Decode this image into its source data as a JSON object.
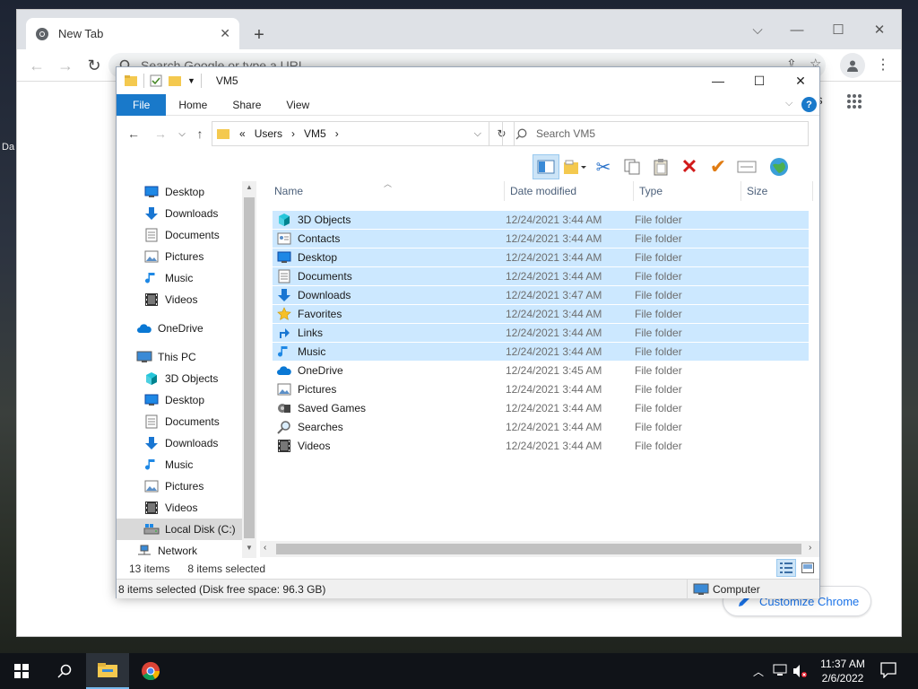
{
  "desktop": {
    "label": "Da"
  },
  "chrome": {
    "tab_title": "New Tab",
    "omnibox_placeholder": "Search Google or type a URL",
    "apps_label": "ges",
    "customize_label": "Customize Chrome"
  },
  "explorer": {
    "title": "VM5",
    "ribbon": [
      "File",
      "Home",
      "Share",
      "View"
    ],
    "address": [
      "Users",
      "VM5"
    ],
    "address_prefix": "«",
    "search_placeholder": "Search VM5",
    "nav": {
      "quick": [
        {
          "label": "Desktop",
          "icon": "desktop-icon"
        },
        {
          "label": "Downloads",
          "icon": "downloads-icon"
        },
        {
          "label": "Documents",
          "icon": "documents-icon"
        },
        {
          "label": "Pictures",
          "icon": "pictures-icon"
        },
        {
          "label": "Music",
          "icon": "music-icon"
        },
        {
          "label": "Videos",
          "icon": "videos-icon"
        }
      ],
      "onedrive": "OneDrive",
      "thispc": "This PC",
      "pc_items": [
        {
          "label": "3D Objects",
          "icon": "3d-objects-icon"
        },
        {
          "label": "Desktop",
          "icon": "desktop-icon"
        },
        {
          "label": "Documents",
          "icon": "documents-icon"
        },
        {
          "label": "Downloads",
          "icon": "downloads-icon"
        },
        {
          "label": "Music",
          "icon": "music-icon"
        },
        {
          "label": "Pictures",
          "icon": "pictures-icon"
        },
        {
          "label": "Videos",
          "icon": "videos-icon"
        },
        {
          "label": "Local Disk (C:)",
          "icon": "drive-icon"
        }
      ],
      "network": "Network"
    },
    "columns": [
      "Name",
      "Date modified",
      "Type",
      "Size"
    ],
    "rows": [
      {
        "name": "3D Objects",
        "date": "12/24/2021 3:44 AM",
        "type": "File folder",
        "icon": "3d-objects-icon",
        "selected": true
      },
      {
        "name": "Contacts",
        "date": "12/24/2021 3:44 AM",
        "type": "File folder",
        "icon": "contacts-icon",
        "selected": true
      },
      {
        "name": "Desktop",
        "date": "12/24/2021 3:44 AM",
        "type": "File folder",
        "icon": "desktop-icon",
        "selected": true
      },
      {
        "name": "Documents",
        "date": "12/24/2021 3:44 AM",
        "type": "File folder",
        "icon": "documents-icon",
        "selected": true
      },
      {
        "name": "Downloads",
        "date": "12/24/2021 3:47 AM",
        "type": "File folder",
        "icon": "downloads-icon",
        "selected": true
      },
      {
        "name": "Favorites",
        "date": "12/24/2021 3:44 AM",
        "type": "File folder",
        "icon": "favorites-icon",
        "selected": true
      },
      {
        "name": "Links",
        "date": "12/24/2021 3:44 AM",
        "type": "File folder",
        "icon": "links-icon",
        "selected": true
      },
      {
        "name": "Music",
        "date": "12/24/2021 3:44 AM",
        "type": "File folder",
        "icon": "music-icon",
        "selected": true
      },
      {
        "name": "OneDrive",
        "date": "12/24/2021 3:45 AM",
        "type": "File folder",
        "icon": "onedrive-icon",
        "selected": false
      },
      {
        "name": "Pictures",
        "date": "12/24/2021 3:44 AM",
        "type": "File folder",
        "icon": "pictures-icon",
        "selected": false
      },
      {
        "name": "Saved Games",
        "date": "12/24/2021 3:44 AM",
        "type": "File folder",
        "icon": "saved-games-icon",
        "selected": false
      },
      {
        "name": "Searches",
        "date": "12/24/2021 3:44 AM",
        "type": "File folder",
        "icon": "searches-icon",
        "selected": false
      },
      {
        "name": "Videos",
        "date": "12/24/2021 3:44 AM",
        "type": "File folder",
        "icon": "videos-icon",
        "selected": false
      }
    ],
    "status_items": "13 items",
    "status_selected": "8 items selected",
    "status_detail": "8 items selected (Disk free space: 96.3 GB)",
    "status_location": "Computer"
  },
  "taskbar": {
    "time": "11:37 AM",
    "date": "2/6/2022"
  },
  "colors": {
    "accent": "#1979ca",
    "selection": "#cce8ff",
    "folder": "#f4c94f"
  }
}
